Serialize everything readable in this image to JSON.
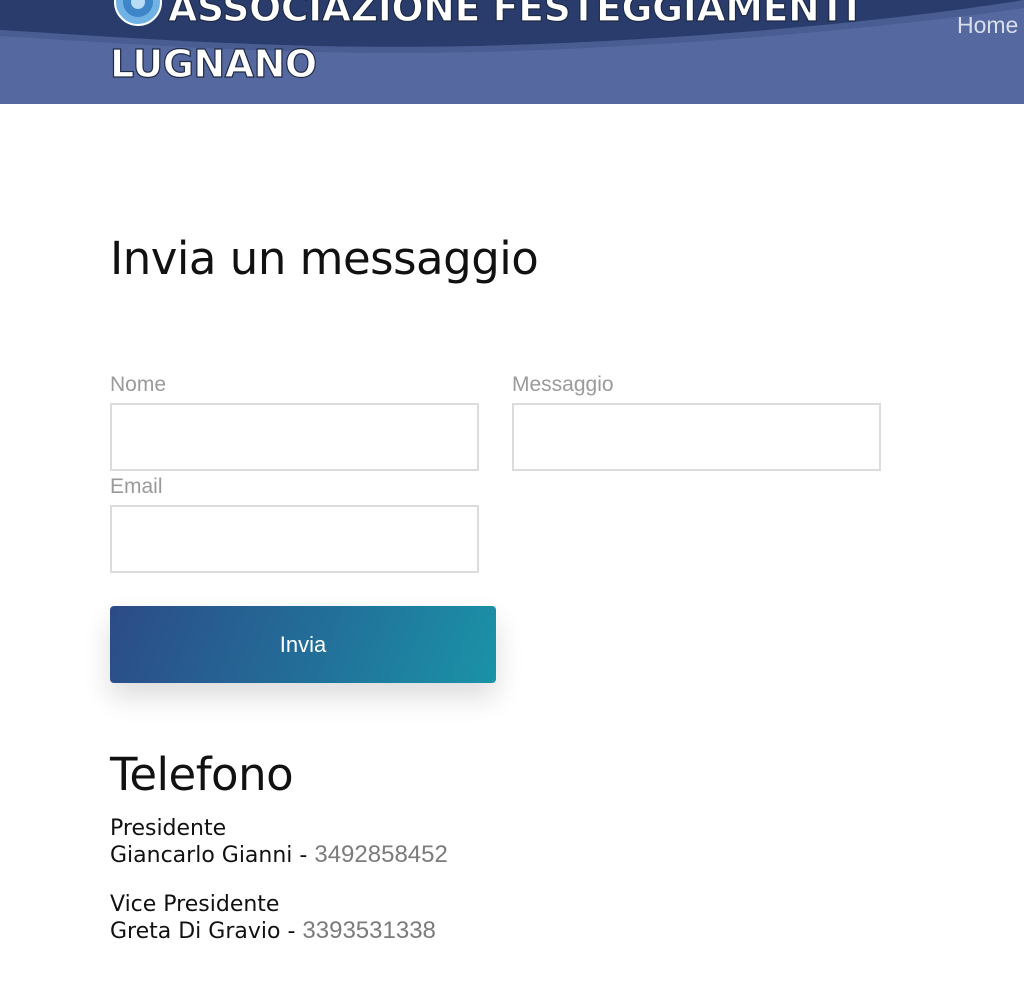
{
  "header": {
    "title_line1": "ASSOCIAZIONE FESTEGGIAMENTI",
    "title_line2": "LUGNANO",
    "nav_home": "Home",
    "background_color": "#5569a0",
    "logo_icon": "association-emblem-icon"
  },
  "contact_form": {
    "heading": "Invia un messaggio",
    "name_label": "Nome",
    "name_value": "",
    "message_label": "Messaggio",
    "message_value": "",
    "email_label": "Email",
    "email_value": "",
    "submit_label": "Invia",
    "submit_gradient": [
      "#2c4b87",
      "#1a93a7"
    ]
  },
  "phone_section": {
    "heading": "Telefono",
    "contacts": [
      {
        "role": "Presidente",
        "name": "Giancarlo Gianni",
        "separator": " - ",
        "phone": "3492858452"
      },
      {
        "role": "Vice Presidente",
        "name": "Greta Di Gravio",
        "separator": " - ",
        "phone": "3393531338"
      }
    ]
  }
}
